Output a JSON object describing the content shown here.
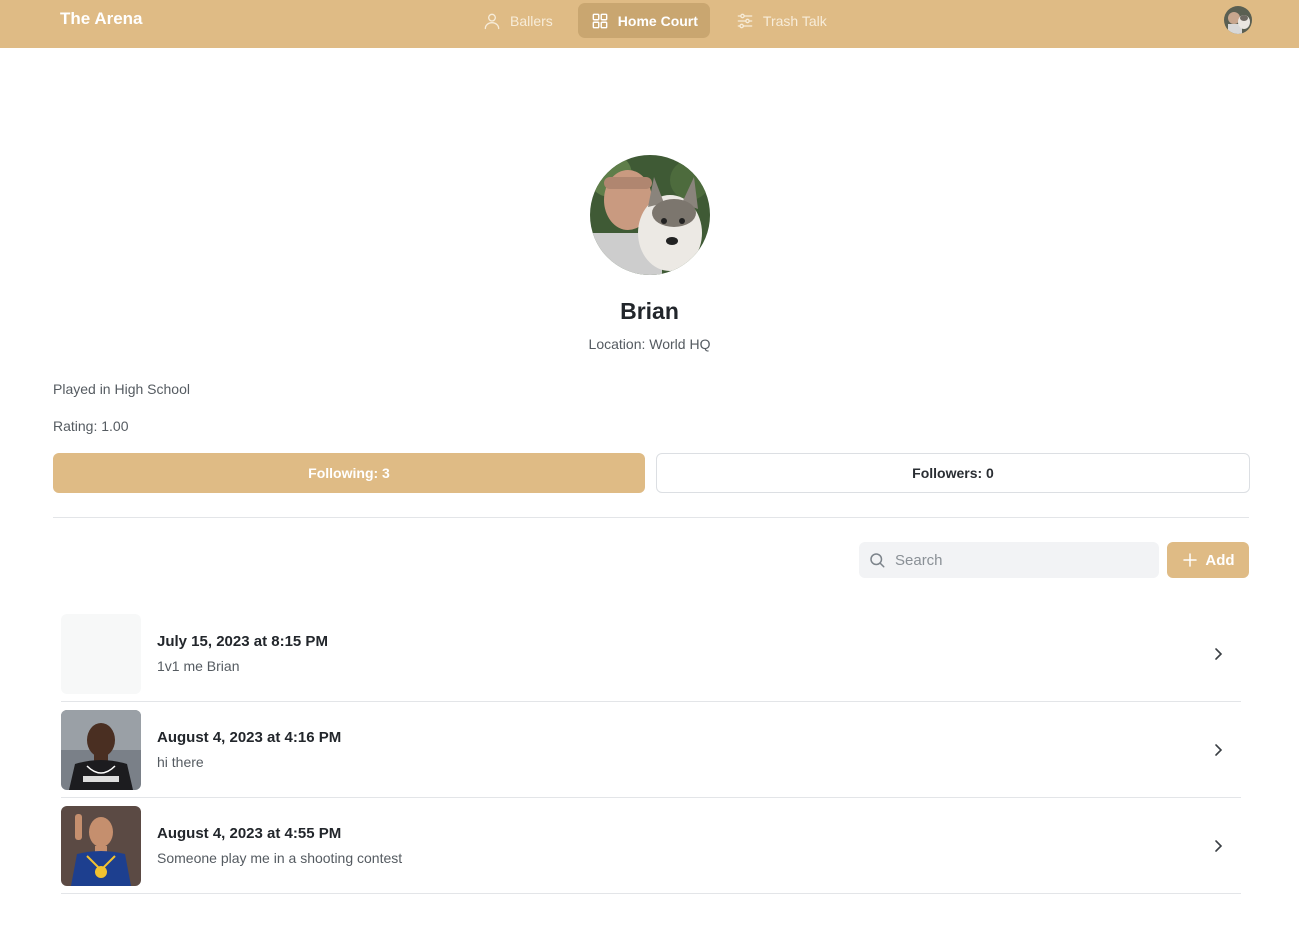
{
  "app": {
    "brand": "The Arena"
  },
  "nav": {
    "items": [
      {
        "label": "Ballers",
        "icon": "user-icon",
        "active": false
      },
      {
        "label": "Home Court",
        "icon": "grid-icon",
        "active": true
      },
      {
        "label": "Trash Talk",
        "icon": "sliders-icon",
        "active": false
      }
    ]
  },
  "profile": {
    "name": "Brian",
    "location": "Location: World HQ",
    "played": "Played in High School",
    "rating": "Rating: 1.00",
    "following_label": "Following: 3",
    "followers_label": "Followers: 0"
  },
  "toolbar": {
    "search_placeholder": "Search",
    "add_label": "Add"
  },
  "posts": [
    {
      "date": "July 15, 2023 at 8:15 PM",
      "text": "1v1 me Brian",
      "thumb": "blank"
    },
    {
      "date": "August 4, 2023 at 4:16 PM",
      "text": "hi there",
      "thumb": "player-brooklyn"
    },
    {
      "date": "August 4, 2023 at 4:55 PM",
      "text": "Someone play me in a shooting contest",
      "thumb": "player-golden-state"
    }
  ],
  "colors": {
    "accent": "#dfbb85",
    "accent_active": "#c9a670",
    "divider": "#e3e5e8"
  }
}
